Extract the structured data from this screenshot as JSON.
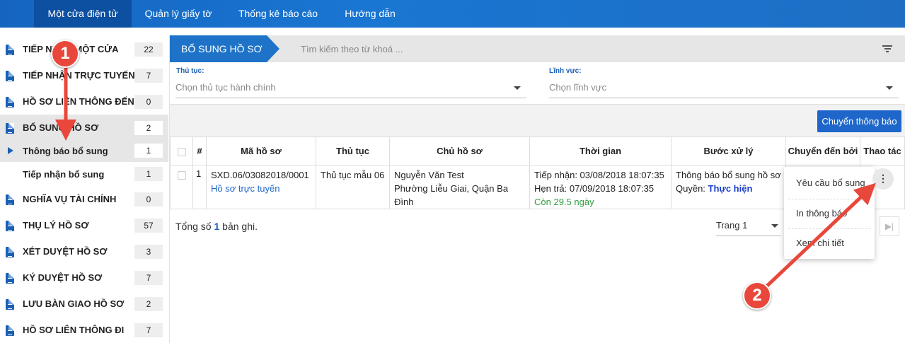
{
  "topnav": {
    "tabs": [
      {
        "label": "Một cửa điện tử"
      },
      {
        "label": "Quản lý giấy tờ"
      },
      {
        "label": "Thống kê báo cáo"
      },
      {
        "label": "Hướng dẫn"
      }
    ]
  },
  "sidebar": {
    "items": [
      {
        "label": "TIẾP NHẬN MỘT CỬA",
        "count": "22"
      },
      {
        "label": "TIẾP NHẬN TRỰC TUYẾN",
        "count": "7"
      },
      {
        "label": "HỒ SƠ LIÊN THÔNG ĐẾN",
        "count": "0"
      },
      {
        "label": "BỔ SUNG HỒ SƠ",
        "count": "2"
      },
      {
        "label": "Thông báo bổ sung",
        "count": "1"
      },
      {
        "label": "Tiếp nhận bổ sung",
        "count": "1"
      },
      {
        "label": "NGHĨA VỤ TÀI CHÍNH",
        "count": "0"
      },
      {
        "label": "THỤ LÝ HỒ SƠ",
        "count": "57"
      },
      {
        "label": "XÉT DUYỆT HỒ SƠ",
        "count": "3"
      },
      {
        "label": "KÝ DUYỆT HỒ SƠ",
        "count": "7"
      },
      {
        "label": "LƯU BÀN GIAO HỒ SƠ",
        "count": "2"
      },
      {
        "label": "HỒ SƠ LIÊN THÔNG ĐI",
        "count": "7"
      }
    ]
  },
  "header": {
    "section_title": "BỔ SUNG HỒ SƠ",
    "search_placeholder": "Tìm kiếm theo từ khoá ..."
  },
  "filters": {
    "procedure_label": "Thủ tục:",
    "procedure_placeholder": "Chọn thủ tục hành chính",
    "field_label": "Lĩnh vực:",
    "field_placeholder": "Chọn lĩnh vực"
  },
  "actions": {
    "forward_notice_button": "Chuyển thông báo"
  },
  "table": {
    "columns": [
      "#",
      "Mã hồ sơ",
      "Thủ tục",
      "Chủ hồ sơ",
      "Thời gian",
      "Bước xử lý",
      "Chuyển đến bởi",
      "Thao tác"
    ],
    "rows": [
      {
        "index": "1",
        "code": "SXD.06/03082018/0001",
        "source": "Hồ sơ trực tuyến",
        "procedure": "Thủ tục mẫu 06",
        "owner_name": "Nguyễn Văn Test",
        "owner_address": "Phường Liễu Giai, Quận Ba Đình",
        "received": "Tiếp nhận: 03/08/2018 18:07:35",
        "due": "Hẹn trả: 07/09/2018 18:07:35",
        "remaining": "Còn 29.5 ngày",
        "step": "Thông báo bổ sung hồ sơ",
        "permission_label": "Quyền:",
        "permission_value": "Thực hiện",
        "more_icon": "vertical-ellipsis-icon"
      }
    ]
  },
  "footer": {
    "total_prefix": "Tổng số",
    "total_count": "1",
    "total_suffix": "bản ghi.",
    "page_select": "Trang 1"
  },
  "context_menu": {
    "items": [
      {
        "label": "Yêu cầu bổ sung"
      },
      {
        "label": "In thông báo"
      },
      {
        "label": "Xem chi tiết"
      }
    ]
  },
  "annotations": {
    "badge_1": "1",
    "badge_2": "2",
    "color": "#e9473b"
  }
}
